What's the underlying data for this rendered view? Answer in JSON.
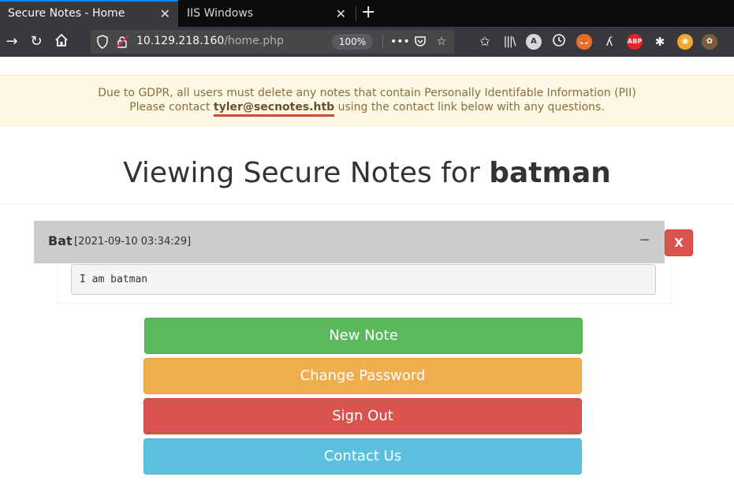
{
  "browser": {
    "tabs": [
      {
        "title": "Secure Notes - Home",
        "active": true
      },
      {
        "title": "IIS Windows",
        "active": false
      }
    ],
    "url": {
      "host": "10.129.218.160",
      "path": "/home.php",
      "zoom": "100%"
    },
    "toolbar_icons": [
      "library-icon",
      "account-icon",
      "history-icon",
      "foxyproxy-icon",
      "wappalyzer-icon",
      "adblock-icon",
      "bug-icon",
      "cookie-icon",
      "extension-icon"
    ],
    "adblock_label": "ABP",
    "account_label": "A"
  },
  "notice": {
    "line1": "Due to GDPR, all users must delete any notes that contain Personally Identifable Information (PII)",
    "line2_pre": "Please contact ",
    "email": "tyler@secnotes.htb",
    "line2_post": " using the contact link below with any questions."
  },
  "page": {
    "heading_pre": "Viewing Secure Notes for ",
    "username": "batman"
  },
  "notes": [
    {
      "title": "Bat",
      "date": "[2021-09-10 03:34:29]",
      "body": "I am batman",
      "collapse_label": "−",
      "delete_label": "X"
    }
  ],
  "actions": {
    "new_note": "New Note",
    "change_password": "Change Password",
    "sign_out": "Sign Out",
    "contact_us": "Contact Us"
  },
  "colors": {
    "success": "#5cb85c",
    "warning": "#f0ad4e",
    "danger": "#d9534f",
    "info": "#5bc0de",
    "notice_bg": "#fcf8e3"
  }
}
